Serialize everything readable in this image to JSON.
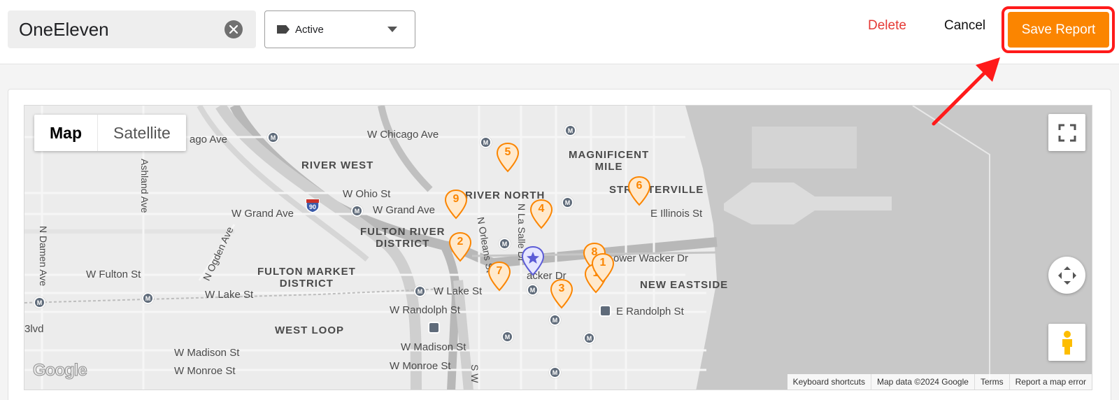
{
  "header": {
    "report_name": "OneEleven",
    "status": "Active",
    "delete_label": "Delete",
    "cancel_label": "Cancel",
    "save_label": "Save Report"
  },
  "map": {
    "map_types": [
      "Map",
      "Satellite"
    ],
    "selected_map_type": "Map",
    "neighborhoods": {
      "river_west": "RIVER WEST",
      "river_north": "RIVER NORTH",
      "magnificent_mile": "MAGNIFICENT\nMILE",
      "streeterville": "STREETERVILLE",
      "fulton_river": "FULTON RIVER\nDISTRICT",
      "fulton_market": "FULTON MARKET\nDISTRICT",
      "new_eastside": "NEW EASTSIDE",
      "west_loop": "WEST LOOP"
    },
    "streets": {
      "chicago_ave_w": "ago Ave",
      "chicago_ave": "W Chicago Ave",
      "ohio_st": "W Ohio St",
      "grand_ave_1": "W Grand Ave",
      "grand_ave_2": "W Grand Ave",
      "illinois_st": "E Illinois St",
      "lower_wacker": "ower Wacker Dr",
      "wacker_dr": "acker Dr",
      "fulton_st": "W Fulton St",
      "lake_st_1": "W Lake St",
      "lake_st_2": "W Lake St",
      "randolph_w": "W Randolph St",
      "randolph_e": "E Randolph St",
      "madison_1": "W Madison St",
      "madison_2": "W Madison St",
      "monroe_1": "W Monroe St",
      "monroe_2": "W Monroe St",
      "blvd": "3lvd",
      "ashland": "Ashland Ave",
      "damen": "N Damen Ave",
      "ogden": "N Ogden Ave",
      "orleans": "N Orleans St",
      "lasalle": "N La Salle Dr",
      "wells": "S W",
      "interstate": "90"
    },
    "markers": [
      {
        "label": "5"
      },
      {
        "label": "6"
      },
      {
        "label": "9"
      },
      {
        "label": "4"
      },
      {
        "label": "2"
      },
      {
        "label": "8"
      },
      {
        "label": "1"
      },
      {
        "label": "1"
      },
      {
        "label": "7"
      },
      {
        "label": "3"
      }
    ],
    "metro_label": "M",
    "attribution": [
      "Keyboard shortcuts",
      "Map data ©2024 Google",
      "Terms",
      "Report a map error"
    ],
    "logo_text": "Google"
  },
  "colors": {
    "accent": "#fb8500",
    "delete": "#e53935",
    "highlight": "#ff1a1a",
    "origin_marker": "#5b5bd6"
  }
}
